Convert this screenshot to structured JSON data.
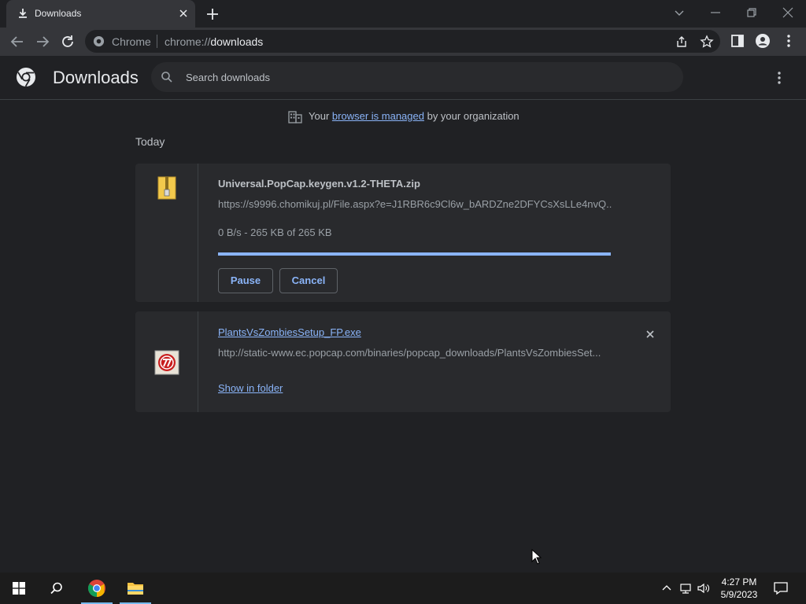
{
  "browser": {
    "tab_title": "Downloads",
    "omnibox_site": "Chrome",
    "omnibox_url_scheme": "chrome://",
    "omnibox_url_host": "downloads"
  },
  "page": {
    "title": "Downloads",
    "search_placeholder": "Search downloads",
    "managed_prefix": "Your",
    "managed_link": "browser is managed",
    "managed_suffix": "by your organization",
    "section_label": "Today"
  },
  "downloads": [
    {
      "name": "Universal.PopCap.keygen.v1.2-THETA.zip",
      "url": "https://s9996.chomikuj.pl/File.aspx?e=J1RBR6c9Cl6w_bARDZne2DFYCsXsLLe4nvQ...",
      "status": "0 B/s - 265 KB of 265 KB",
      "progress": 1.0,
      "pause_label": "Pause",
      "cancel_label": "Cancel",
      "icon": "zip-file-icon"
    },
    {
      "name": "PlantsVsZombiesSetup_FP.exe",
      "url": "http://static-www.ec.popcap.com/binaries/popcap_downloads/PlantsVsZombiesSet...",
      "show_in_folder_label": "Show in folder",
      "icon": "popcap-exe-icon"
    }
  ],
  "taskbar": {
    "time": "4:27 PM",
    "date": "5/9/2023"
  },
  "colors": {
    "accent": "#8ab4f8",
    "background": "#202124",
    "card": "#292a2d"
  }
}
